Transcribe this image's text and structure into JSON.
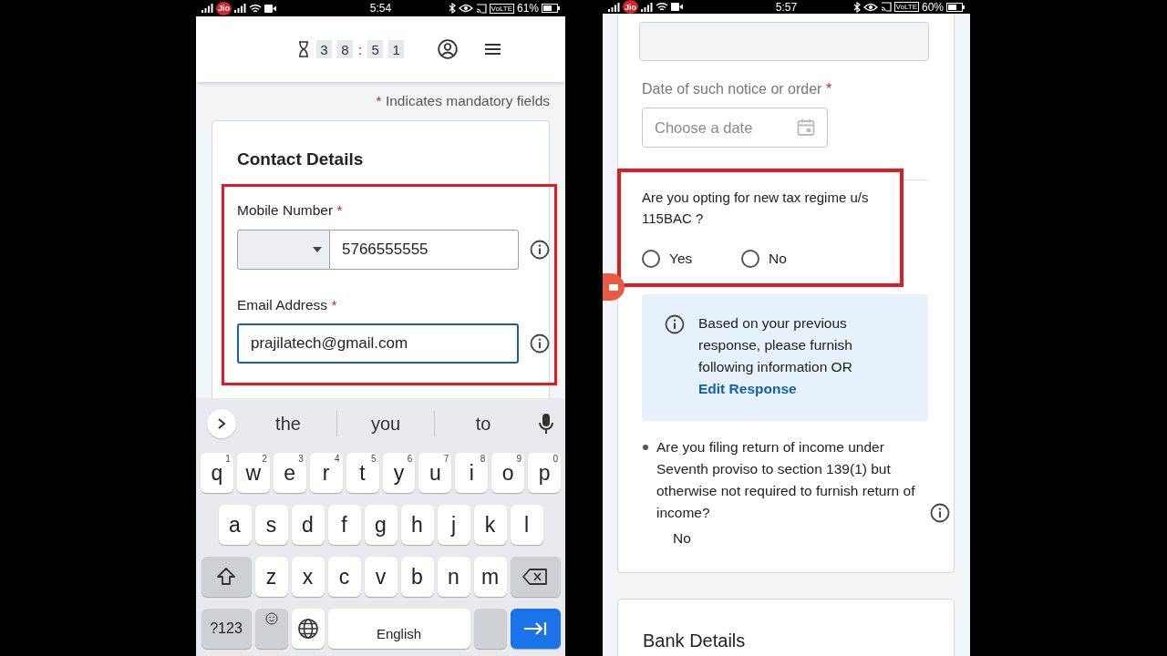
{
  "left_screen": {
    "status_bar": {
      "carrier": "Jio",
      "time": "5:54",
      "network": "VoLTE",
      "battery": "61%"
    },
    "timer": {
      "digits": [
        "3",
        "8",
        ":",
        "5",
        "1"
      ]
    },
    "mandatory_note": {
      "mark": "*",
      "text": "Indicates mandatory fields"
    },
    "card": {
      "title": "Contact Details",
      "highlighted": true,
      "fields": [
        {
          "kind": "phone",
          "label": "Mobile Number",
          "mark": "*",
          "value": "5766555555",
          "focused": false
        },
        {
          "kind": "text",
          "label": "Email Address",
          "mark": "*",
          "value": "prajilatech@gmail.com",
          "focused": true
        }
      ]
    },
    "keyboard": {
      "suggestions": [
        "the",
        "you",
        "to"
      ],
      "letter_rows": [
        [
          {
            "kind": "char",
            "label": "q",
            "hint": "1"
          },
          {
            "kind": "char",
            "label": "w",
            "hint": "2"
          },
          {
            "kind": "char",
            "label": "e",
            "hint": "3"
          },
          {
            "kind": "char",
            "label": "r",
            "hint": "4"
          },
          {
            "kind": "char",
            "label": "t",
            "hint": "5"
          },
          {
            "kind": "char",
            "label": "y",
            "hint": "6"
          },
          {
            "kind": "char",
            "label": "u",
            "hint": "7"
          },
          {
            "kind": "char",
            "label": "i",
            "hint": "8"
          },
          {
            "kind": "char",
            "label": "o",
            "hint": "9"
          },
          {
            "kind": "char",
            "label": "p",
            "hint": "0"
          }
        ],
        [
          {
            "kind": "char",
            "label": "a"
          },
          {
            "kind": "char",
            "label": "s"
          },
          {
            "kind": "char",
            "label": "d"
          },
          {
            "kind": "char",
            "label": "f"
          },
          {
            "kind": "char",
            "label": "g"
          },
          {
            "kind": "char",
            "label": "h"
          },
          {
            "kind": "char",
            "label": "j"
          },
          {
            "kind": "char",
            "label": "k"
          },
          {
            "kind": "char",
            "label": "l"
          }
        ],
        [
          {
            "kind": "shift"
          },
          {
            "kind": "char",
            "label": "z"
          },
          {
            "kind": "char",
            "label": "x"
          },
          {
            "kind": "char",
            "label": "c"
          },
          {
            "kind": "char",
            "label": "v"
          },
          {
            "kind": "char",
            "label": "b"
          },
          {
            "kind": "char",
            "label": "n"
          },
          {
            "kind": "char",
            "label": "m"
          },
          {
            "kind": "backspace"
          }
        ]
      ],
      "bottom_bar": {
        "symbols_key": "?123",
        "space_key": "English"
      }
    }
  },
  "right_screen": {
    "status_bar": {
      "carrier": "Jio",
      "time": "5:57",
      "network": "VoLTE",
      "battery": "60%"
    },
    "date_field": {
      "label": "Date of such notice or order",
      "mark": "*",
      "placeholder": "Choose a date"
    },
    "question": {
      "text": "Are you opting for new tax regime u/s 115BAC ?",
      "highlighted": true,
      "options": [
        {
          "label": "Yes",
          "selected": false
        },
        {
          "label": "No",
          "selected": false
        }
      ]
    },
    "info_box": {
      "text": "Based on your previous response, please furnish following information  OR",
      "link": "Edit Response"
    },
    "bullets": [
      {
        "question": "Are you filing return of income under Seventh proviso to section 139(1) but otherwise not required to furnish return of income?",
        "answer": "No"
      }
    ],
    "next_section": {
      "title": "Bank Details"
    }
  }
}
